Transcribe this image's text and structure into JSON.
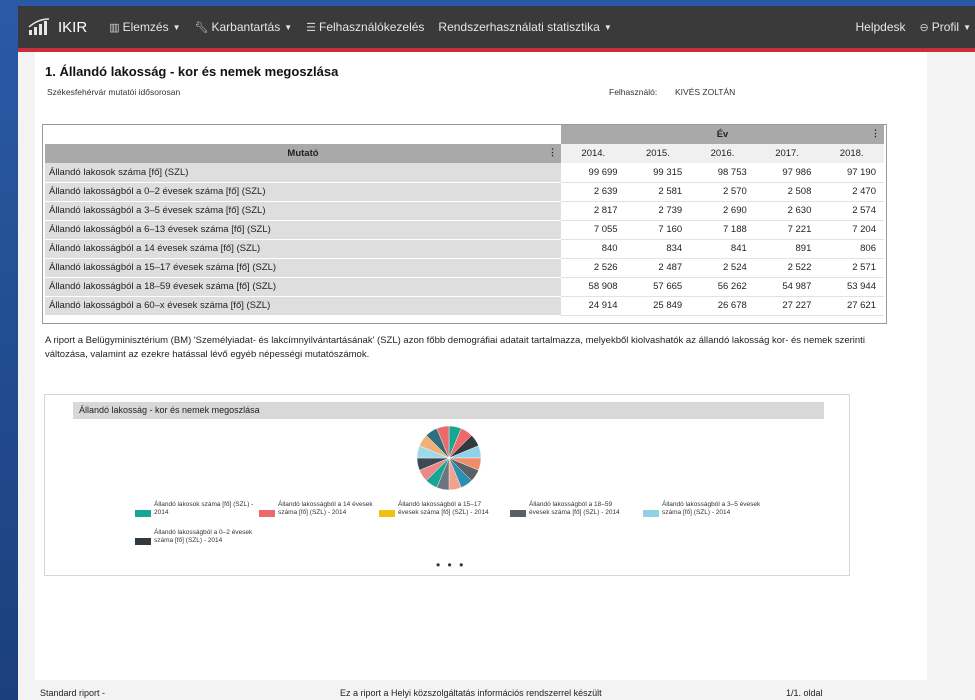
{
  "navbar": {
    "brand": "IKIR",
    "items": [
      {
        "label": "Elemzés",
        "icon": "bar-chart-icon",
        "caret": true
      },
      {
        "label": "Karbantartás",
        "icon": "wrench-icon",
        "caret": true
      },
      {
        "label": "Felhasználókezelés",
        "icon": "list-icon",
        "caret": false
      },
      {
        "label": "Rendszerhasználati statisztika",
        "icon": "",
        "caret": true
      }
    ],
    "helpdesk": "Helpdesk",
    "profile": "Profil"
  },
  "report": {
    "title": "1. Állandó lakosság - kor és nemek megoszlása",
    "subtitle": "Székesfehérvár mutatói idősorosan",
    "user_label": "Felhasználó:",
    "user_name": "KIVÉS ZOLTÁN",
    "description": "A riport a Belügyminisztérium (BM) 'Személyiadat- és lakcímnyilvántartásának' (SZL) azon főbb demográfiai adatait tartalmazza, melyekből kiolvashatók az állandó lakosság kor- és nemek szerinti változása, valamint az ezekre hatással lévő egyéb népességi mutatószámok."
  },
  "table": {
    "year_group": "Év",
    "mutato_header": "Mutató",
    "menu": "⋮",
    "years": [
      "2014.",
      "2015.",
      "2016.",
      "2017.",
      "2018."
    ],
    "rows": [
      {
        "label": "Állandó lakosok száma [fő] (SZL)",
        "values": [
          "99 699",
          "99 315",
          "98 753",
          "97 986",
          "97 190"
        ]
      },
      {
        "label": "Állandó lakosságból a 0–2 évesek száma [fő] (SZL)",
        "values": [
          "2 639",
          "2 581",
          "2 570",
          "2 508",
          "2 470"
        ]
      },
      {
        "label": "Állandó lakosságból a 3–5 évesek száma [fő] (SZL)",
        "values": [
          "2 817",
          "2 739",
          "2 690",
          "2 630",
          "2 574"
        ]
      },
      {
        "label": "Állandó lakosságból a 6–13 évesek száma [fő] (SZL)",
        "values": [
          "7 055",
          "7 160",
          "7 188",
          "7 221",
          "7 204"
        ]
      },
      {
        "label": "Állandó lakosságból a 14 évesek száma [fő] (SZL)",
        "values": [
          "840",
          "834",
          "841",
          "891",
          "806"
        ]
      },
      {
        "label": "Állandó lakosságból a 15–17 évesek száma [fő] (SZL)",
        "values": [
          "2 526",
          "2 487",
          "2 524",
          "2 522",
          "2 571"
        ]
      },
      {
        "label": "Állandó lakosságból a 18–59 évesek száma [fő] (SZL)",
        "values": [
          "58 908",
          "57 665",
          "56 262",
          "54 987",
          "53 944"
        ]
      },
      {
        "label": "Állandó lakosságból a 60–x évesek száma [fő] (SZL)",
        "values": [
          "24 914",
          "25 849",
          "26 678",
          "27 227",
          "27 621"
        ]
      }
    ]
  },
  "chart": {
    "title": "Állandó lakosság - kor és nemek megoszlása",
    "more": "• • •",
    "legend": [
      {
        "label": "Állandó lakosok száma [fő] (SZL) - 2014",
        "color": "#17a693"
      },
      {
        "label": "Állandó lakosságból a 0–2 évesek száma [fő] (SZL) - 2014",
        "color": "#333a3f"
      },
      {
        "label": "Állandó lakosságból a 14 évesek száma [fő] (SZL) - 2014",
        "color": "#ee6a6a"
      },
      {
        "label": "Állandó lakosságból a 15–17 évesek száma [fő] (SZL) - 2014",
        "color": "#f2c012"
      },
      {
        "label": "Állandó lakosságból a 18–59 évesek száma [fő] (SZL) - 2014",
        "color": "#5a6066"
      },
      {
        "label": "Állandó lakosságból a 3–5 évesek száma [fő] (SZL) - 2014",
        "color": "#8fd1e6"
      }
    ],
    "pie_colors": [
      "#17a693",
      "#ee6a6a",
      "#333a3f",
      "#8fd1e6",
      "#f08b6c",
      "#5a6066",
      "#2a8fb0",
      "#f2a08f",
      "#6c7480",
      "#17a693",
      "#e88a8a",
      "#3d4a55",
      "#9fd9e8",
      "#f0b07a",
      "#2d6f80",
      "#ee6a6a"
    ]
  },
  "chart_data": {
    "type": "pie",
    "title": "Állandó lakosság - kor és nemek megoszlása",
    "slices": 16
  },
  "footer": {
    "left": "Standard riport -",
    "center": "Ez a riport a Helyi közszolgáltatás információs rendszerrel készült",
    "right": "1/1. oldal"
  }
}
